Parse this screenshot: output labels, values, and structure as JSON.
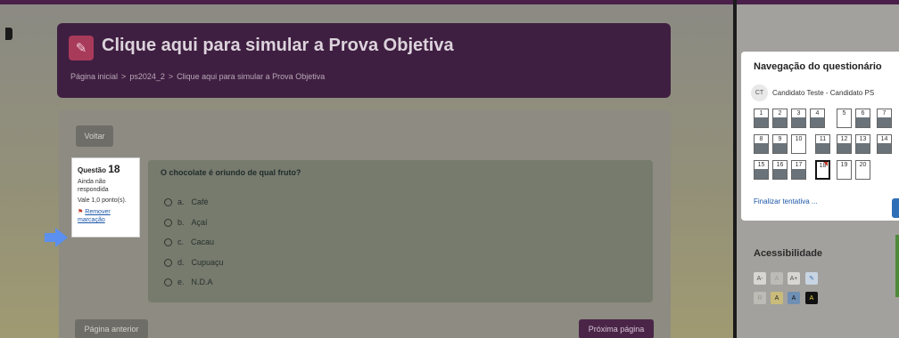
{
  "header": {
    "title": "Clique aqui para simular a Prova Objetiva",
    "breadcrumb": [
      "Página inicial",
      "ps2024_2",
      "Clique aqui para simular a Prova Objetiva"
    ],
    "breadcrumb_sep": ">"
  },
  "actions": {
    "back": "Voltar",
    "prev": "Página anterior",
    "next": "Próxima página"
  },
  "question_info": {
    "label": "Questão",
    "number": "18",
    "status": "Ainda não respondida",
    "value": "Vale 1,0 ponto(s).",
    "flag_link": "Remover marcação"
  },
  "question": {
    "text": "O chocolate é oriundo de qual fruto?",
    "options": [
      {
        "letter": "a.",
        "text": "Café"
      },
      {
        "letter": "b.",
        "text": "Açaí"
      },
      {
        "letter": "c.",
        "text": "Cacau"
      },
      {
        "letter": "d.",
        "text": "Cupuaçu"
      },
      {
        "letter": "e.",
        "text": "N.D.A"
      }
    ]
  },
  "quiz_nav": {
    "title": "Navegação do questionário",
    "user_initials": "CT",
    "user_name": "Candidato Teste - Candidato PS",
    "cells": [
      "1",
      "2",
      "3",
      "4",
      "5",
      "6",
      "7",
      "8",
      "9",
      "10",
      "11",
      "12",
      "13",
      "14",
      "15",
      "16",
      "17",
      "18",
      "19",
      "20"
    ],
    "finish": "Finalizar tentativa ..."
  },
  "accessibility": {
    "title": "Acessibilidade",
    "font_buttons": [
      "A-",
      "A",
      "A+"
    ],
    "contrast_buttons": [
      "R",
      "A",
      "A",
      "A"
    ]
  },
  "colors": {
    "brand": "#3f1f41",
    "flag": "#c0392b",
    "link": "#1a55a8"
  }
}
